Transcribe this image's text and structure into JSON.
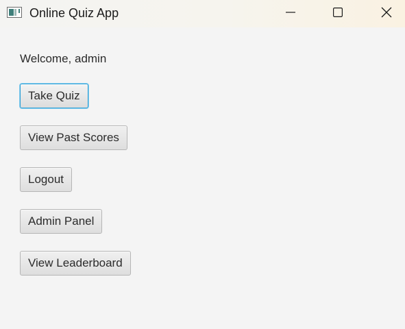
{
  "window": {
    "title": "Online Quiz App",
    "icon": "java-app-icon",
    "controls": {
      "minimize_icon": "minimize-icon",
      "maximize_icon": "maximize-icon",
      "close_icon": "close-icon"
    }
  },
  "main": {
    "welcome_text": "Welcome, admin",
    "buttons": [
      {
        "label": "Take Quiz",
        "focused": true
      },
      {
        "label": "View Past Scores",
        "focused": false
      },
      {
        "label": "Logout",
        "focused": false
      },
      {
        "label": "Admin Panel",
        "focused": false
      },
      {
        "label": "View Leaderboard",
        "focused": false
      }
    ]
  },
  "colors": {
    "focus_ring": "#2a9fd6",
    "background": "#f4f4f4"
  }
}
